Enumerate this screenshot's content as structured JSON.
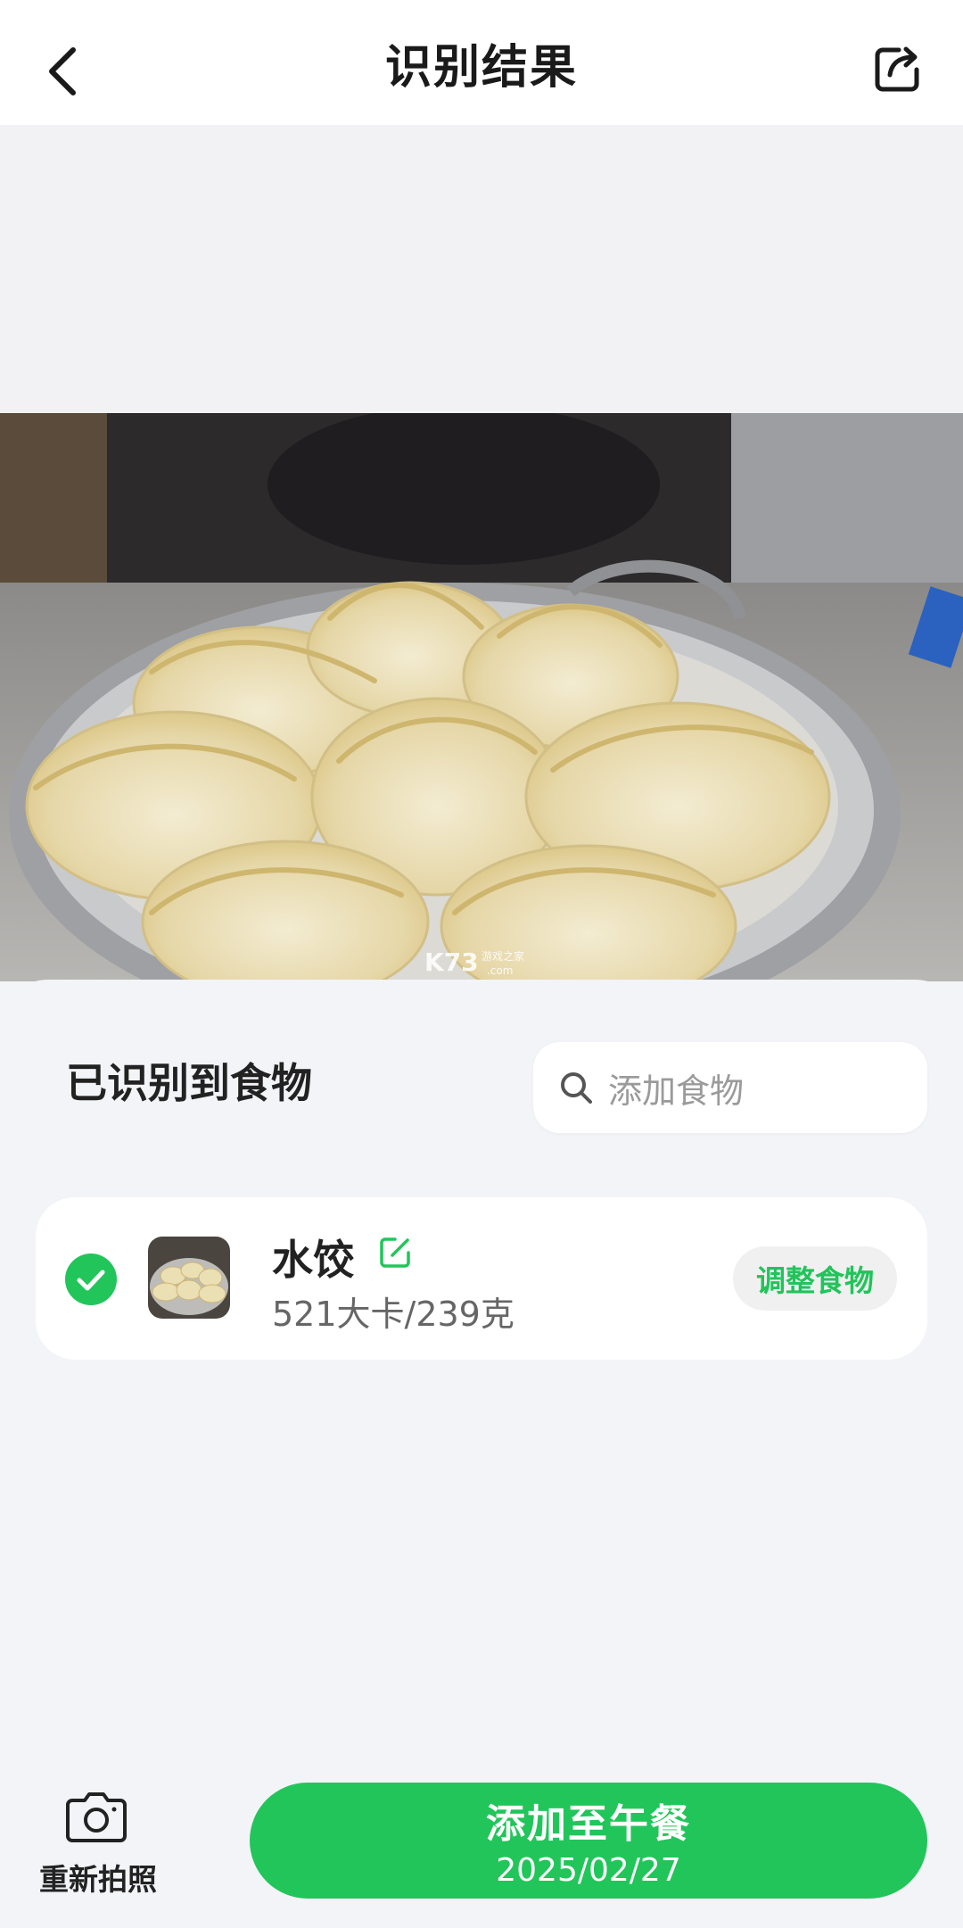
{
  "header": {
    "title": "识别结果",
    "back_icon": "chevron-left-icon",
    "share_icon": "share-icon"
  },
  "photo": {
    "description_icon": "dumplings-photo",
    "watermark": "K73 游戏之家 .com"
  },
  "recognized": {
    "section_title": "已识别到食物",
    "search": {
      "placeholder": "添加食物",
      "icon": "search-icon"
    },
    "items": [
      {
        "selected": true,
        "name": "水饺",
        "calories_weight": "521大卡/239克",
        "adjust_label": "调整食物"
      }
    ]
  },
  "footer": {
    "retake_label": "重新拍照",
    "add_label": "添加至午餐",
    "date": "2025/02/27"
  },
  "colors": {
    "accent_green": "#22c55a",
    "background": "#f3f4f8",
    "card": "#ffffff"
  }
}
